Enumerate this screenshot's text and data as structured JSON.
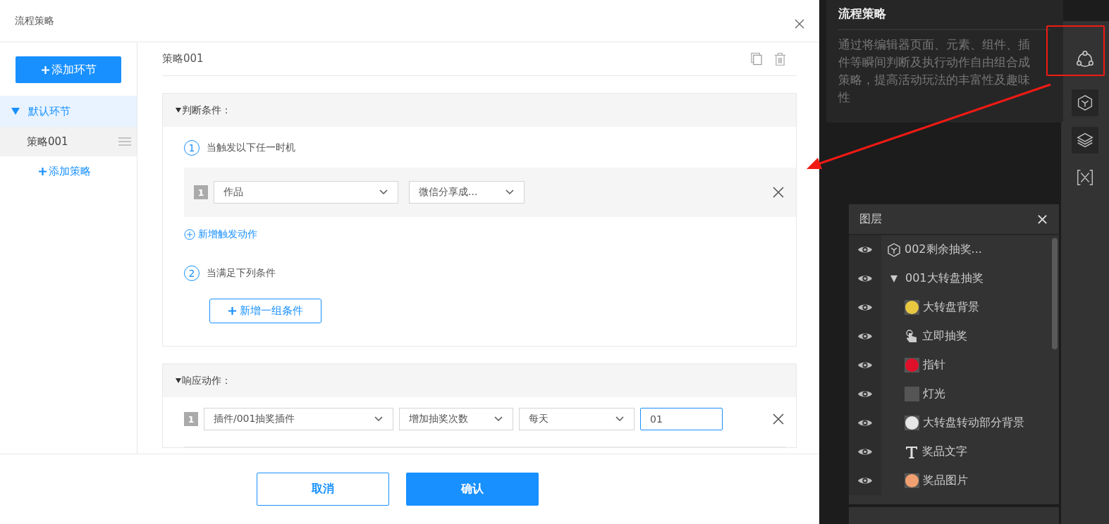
{
  "dialog": {
    "title": "流程策略"
  },
  "sidebar": {
    "add_stage_button": "添加环节",
    "stages": [
      {
        "label": "默认环节",
        "expanded": true,
        "children": [
          {
            "label": "策略001",
            "selected": true
          }
        ]
      }
    ],
    "add_strategy_link": "添加策略"
  },
  "strategy": {
    "name": "策略001"
  },
  "conditions": {
    "title": "判断条件：",
    "expanded": true,
    "trigger_step": {
      "number": "1",
      "label": "当触发以下任一时机"
    },
    "triggers": [
      {
        "index": "1",
        "selects": [
          "作品",
          "微信分享成..."
        ]
      }
    ],
    "add_trigger_link": "新增触发动作",
    "condition_step": {
      "number": "2",
      "label": "当满足下列条件"
    },
    "add_group_button": "新增一组条件"
  },
  "actions": {
    "title": "响应动作：",
    "expanded": true,
    "rows": [
      {
        "index": "1",
        "selects": [
          "插件/001抽奖插件",
          "增加抽奖次数",
          "每天"
        ],
        "value": "01"
      }
    ]
  },
  "footer": {
    "cancel": "取消",
    "confirm": "确认"
  },
  "tooltip": {
    "title": "流程策略",
    "text": "通过将编辑器页面、元素、组件、插件等瞬间判断及执行动作自由组合成策略，提高活动玩法的丰富性及趣味性"
  },
  "layers_panel": {
    "title": "图层",
    "items": [
      {
        "kind": "component",
        "label": "002剩余抽奖..."
      },
      {
        "kind": "group",
        "label": "001大转盘抽奖",
        "expanded": true,
        "children": [
          {
            "kind": "image",
            "label": "大转盘背景",
            "color": "#e8c840"
          },
          {
            "kind": "button",
            "label": "立即抽奖"
          },
          {
            "kind": "image",
            "label": "指针",
            "color": "#e0102a"
          },
          {
            "kind": "image",
            "label": "灯光",
            "color": "#555555"
          },
          {
            "kind": "image",
            "label": "大转盘转动部分背景",
            "color": "#e6e6e6"
          },
          {
            "kind": "text",
            "label": "奖品文字"
          },
          {
            "kind": "image",
            "label": "奖品图片",
            "color": "#f0a070"
          }
        ]
      }
    ]
  }
}
